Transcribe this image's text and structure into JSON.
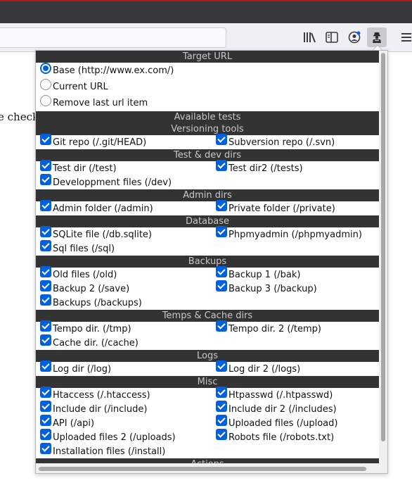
{
  "toolbar": {
    "icons": [
      "library-icon",
      "sidebar-icon",
      "account-icon",
      "extension-icon",
      "menu-icon"
    ]
  },
  "page": {
    "partial_text": "e check"
  },
  "popup": {
    "target_header": "Target URL",
    "target_options": [
      {
        "label": "Base (http://www.ex.com/)",
        "checked": true
      },
      {
        "label": "Current URL",
        "checked": false
      },
      {
        "label": "Remove last url item",
        "checked": false
      }
    ],
    "available_header": "Available tests",
    "sections": [
      {
        "title": "Versioning tools",
        "items": [
          "Git repo (/.git/HEAD)",
          "Subversion repo (/.svn)"
        ]
      },
      {
        "title": "Test & dev dirs",
        "items": [
          "Test dir (/test)",
          "Test dir2 (/tests)",
          "Developpment files (/dev)"
        ]
      },
      {
        "title": "Admin dirs",
        "items": [
          "Admin folder (/admin)",
          "Private folder (/private)"
        ]
      },
      {
        "title": "Database",
        "items": [
          "SQLite file (/db.sqlite)",
          "Phpmyadmin (/phpmyadmin)",
          "Sql files (/sql)"
        ]
      },
      {
        "title": "Backups",
        "items": [
          "Old files (/old)",
          "Backup 1 (/bak)",
          "Backup 2 (/save)",
          "Backup 3 (/backup)",
          "Backups (/backups)"
        ]
      },
      {
        "title": "Temps & Cache dirs",
        "items": [
          "Tempo dir. (/tmp)",
          "Tempo dir. 2 (/temp)",
          "Cache dir. (/cache)"
        ]
      },
      {
        "title": "Logs",
        "items": [
          "Log dir (/log)",
          "Log dir 2 (/logs)"
        ]
      },
      {
        "title": "Misc",
        "items": [
          "Htaccess (/.htaccess)",
          "Htpasswd (/.htpasswd)",
          "Include dir (/include)",
          "Include dir 2 (/includes)",
          "API (/api)",
          "Uploaded files (/upload)",
          "Uploaded files 2 (/uploads)",
          "Robots file (/robots.txt)",
          "Installation files (/install)"
        ]
      },
      {
        "title": "Actions",
        "items": []
      }
    ]
  }
}
